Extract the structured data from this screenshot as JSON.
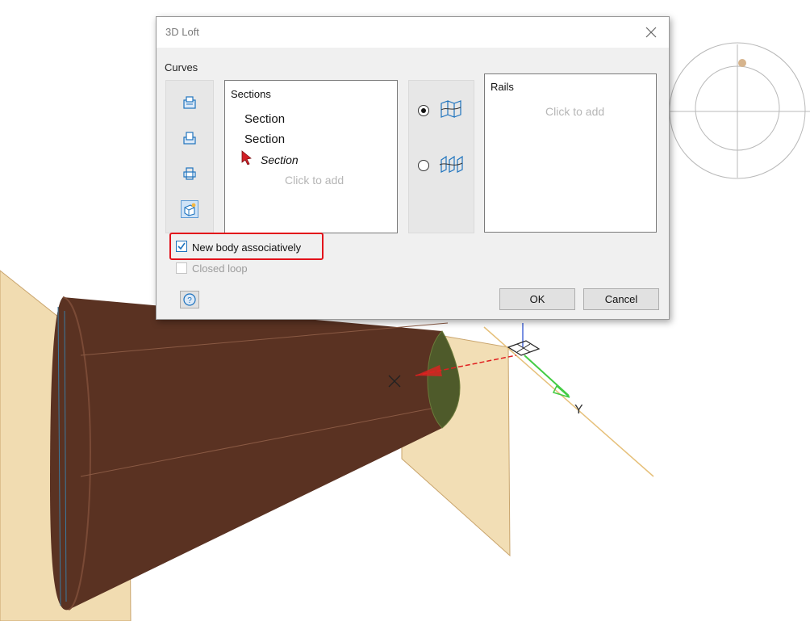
{
  "dialog": {
    "title": "3D Loft",
    "group_label": "Curves",
    "sections": {
      "title": "Sections",
      "items": [
        {
          "label": "Section",
          "style": "normal"
        },
        {
          "label": "Section",
          "style": "normal"
        },
        {
          "label": "Section",
          "style": "italic"
        }
      ],
      "placeholder": "Click to add"
    },
    "rails": {
      "title": "Rails",
      "placeholder": "Click to add"
    },
    "mode": {
      "selected": 0,
      "options": [
        "loft-sections-icon",
        "loft-rails-icon"
      ]
    },
    "checkboxes": {
      "new_body_label": "New body associatively",
      "new_body_checked": true,
      "closed_loop_label": "Closed loop",
      "closed_loop_checked": false
    },
    "buttons": {
      "ok": "OK",
      "cancel": "Cancel",
      "help": "?"
    }
  },
  "viewport": {
    "axis_label": "Y",
    "body_color": "#5a3222",
    "plane_color": "#f0d8a8"
  },
  "colors": {
    "highlight": "#e2121b",
    "accent": "#1e73be"
  }
}
